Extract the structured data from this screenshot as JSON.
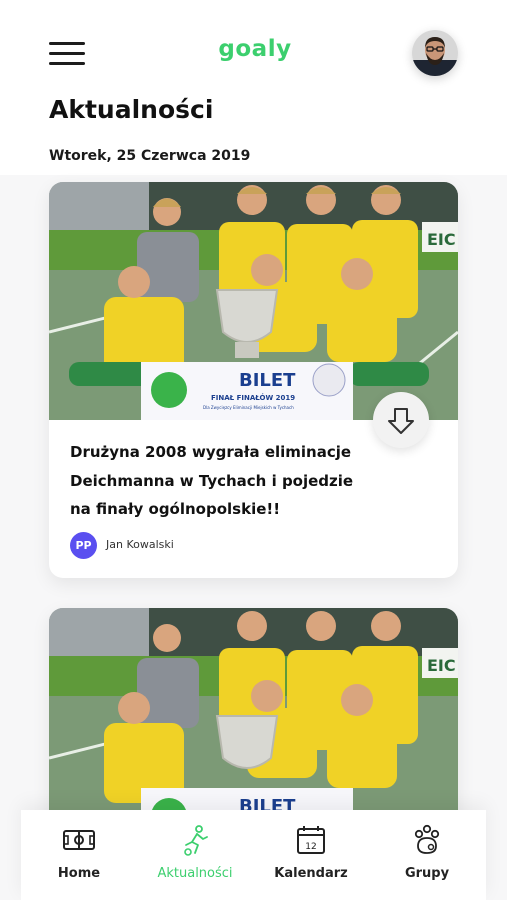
{
  "header": {
    "logo": "goaly",
    "title": "Aktualności",
    "date": "Wtorek, 25 Czerwca 2019"
  },
  "icons": {
    "menu": "hamburger-menu-icon",
    "share": "share-arrow-icon",
    "home": "field-icon",
    "news": "runner-icon",
    "calendar": "calendar-icon",
    "groups": "paw-group-icon"
  },
  "colors": {
    "accent": "#3ccf6e",
    "author_badge": "#5a4ff0"
  },
  "posts": [
    {
      "title": "Drużyna 2008 wygrała eliminacje Deichmanna w Tychach i pojedzie na finały ogólnopolskie!!",
      "author_initials": "PP",
      "author_name": "Jan Kowalski",
      "banner_title": "BILET",
      "banner_subtitle": "FINAŁ FINAŁÓW 2019",
      "banner_note": "Dla Zwycięzcy Eliminacji Miejskich w Tychach",
      "sign_text": "EIC"
    },
    {
      "banner_title": "BILET",
      "sign_text": "EIC"
    }
  ],
  "nav": {
    "items": [
      {
        "label": "Home",
        "icon": "field-icon",
        "active": false
      },
      {
        "label": "Aktualności",
        "icon": "runner-icon",
        "active": true
      },
      {
        "label": "Kalendarz",
        "icon": "calendar-icon",
        "active": false,
        "calendar_day": "12"
      },
      {
        "label": "Grupy",
        "icon": "paw-group-icon",
        "active": false
      }
    ]
  }
}
